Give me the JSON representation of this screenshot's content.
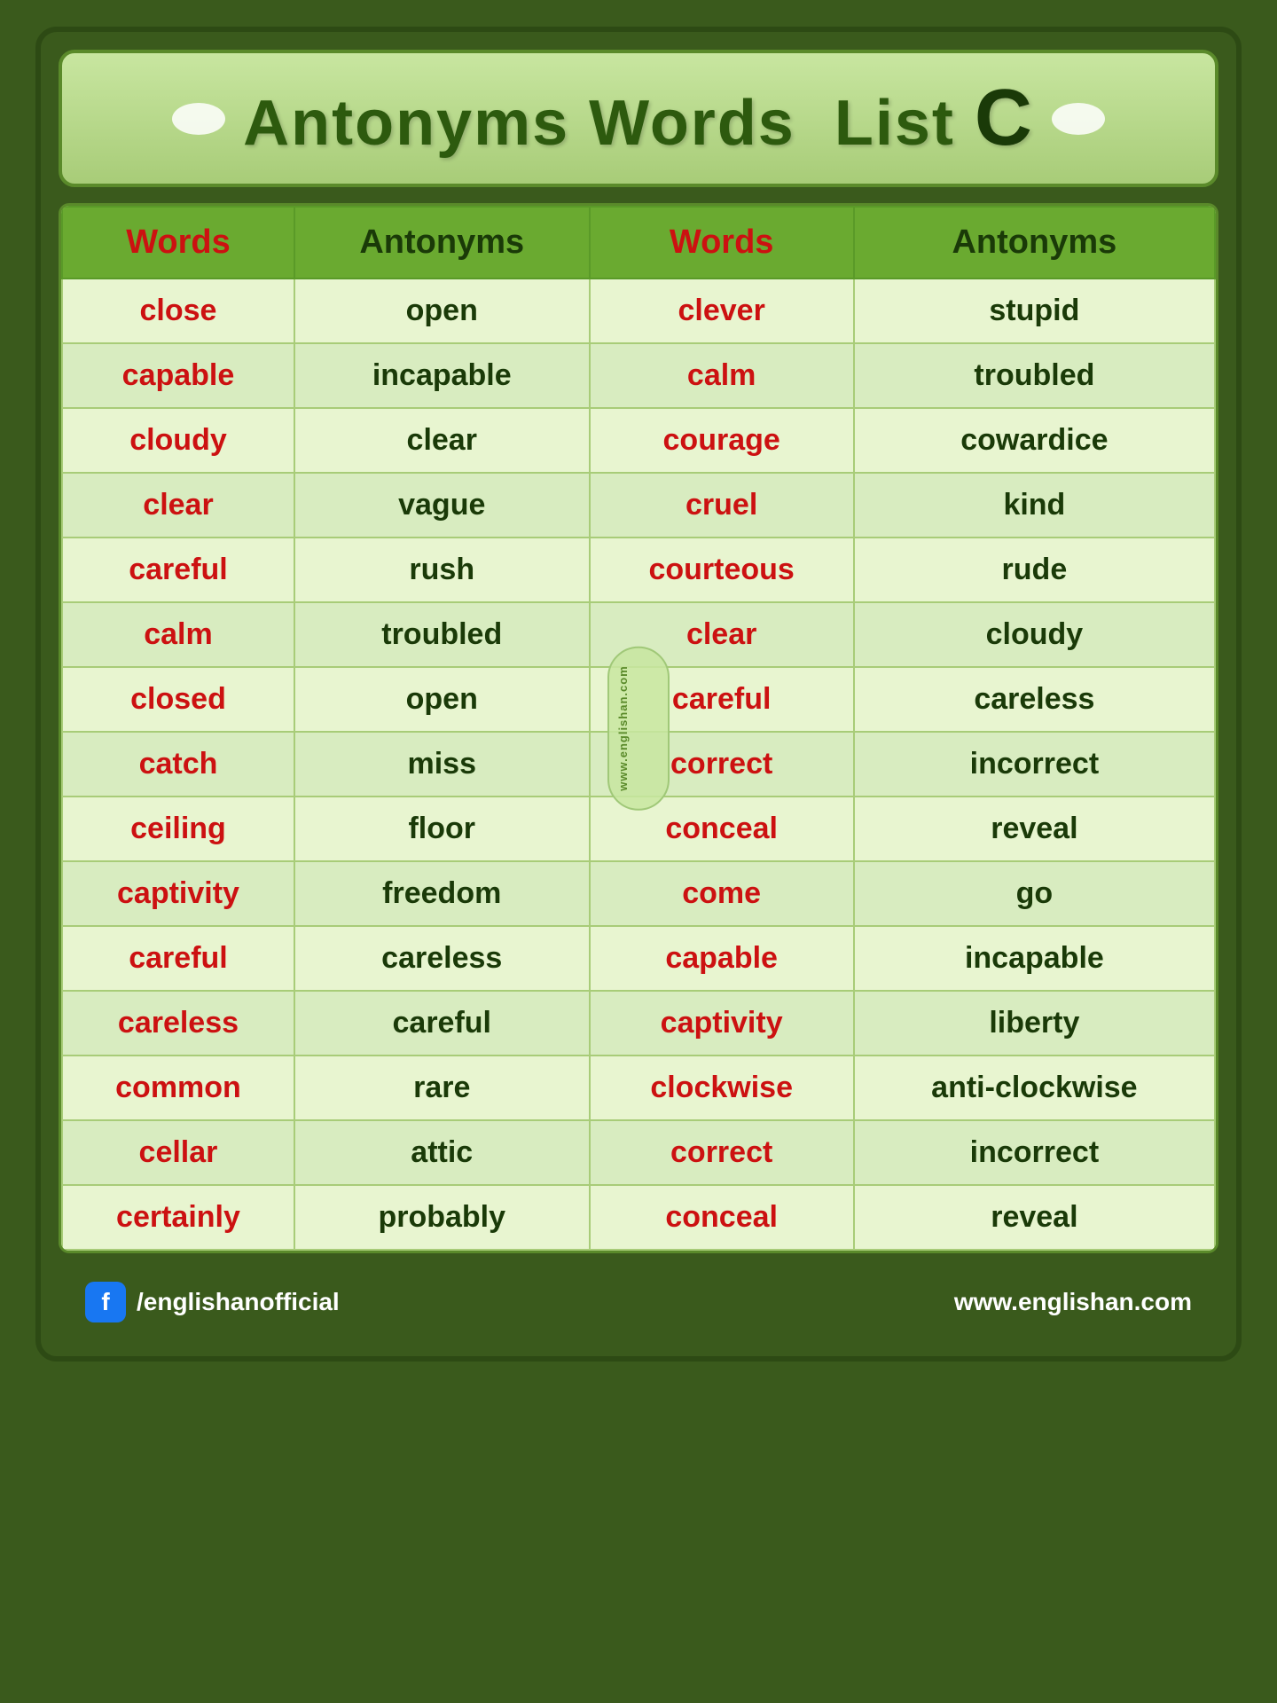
{
  "header": {
    "title": "Antonyms Words  List",
    "letter": "C",
    "oval_count": 2
  },
  "columns": {
    "col1_header": "Words",
    "col2_header": "Antonyms",
    "col3_header": "Words",
    "col4_header": "Antonyms"
  },
  "rows": [
    {
      "word1": "close",
      "ant1": "open",
      "word2": "clever",
      "ant2": "stupid"
    },
    {
      "word1": "capable",
      "ant1": "incapable",
      "word2": "calm",
      "ant2": "troubled"
    },
    {
      "word1": "cloudy",
      "ant1": "clear",
      "word2": "courage",
      "ant2": "cowardice"
    },
    {
      "word1": "clear",
      "ant1": "vague",
      "word2": "cruel",
      "ant2": "kind"
    },
    {
      "word1": "careful",
      "ant1": "rush",
      "word2": "courteous",
      "ant2": "rude"
    },
    {
      "word1": "calm",
      "ant1": "troubled",
      "word2": "clear",
      "ant2": "cloudy"
    },
    {
      "word1": "closed",
      "ant1": "open",
      "word2": "careful",
      "ant2": "careless"
    },
    {
      "word1": "catch",
      "ant1": "miss",
      "word2": "correct",
      "ant2": "incorrect"
    },
    {
      "word1": "ceiling",
      "ant1": "floor",
      "word2": "conceal",
      "ant2": "reveal"
    },
    {
      "word1": "captivity",
      "ant1": "freedom",
      "word2": "come",
      "ant2": "go"
    },
    {
      "word1": "careful",
      "ant1": "careless",
      "word2": "capable",
      "ant2": "incapable"
    },
    {
      "word1": "careless",
      "ant1": "careful",
      "word2": "captivity",
      "ant2": "liberty"
    },
    {
      "word1": "common",
      "ant1": "rare",
      "word2": "clockwise",
      "ant2": "anti-clockwise"
    },
    {
      "word1": "cellar",
      "ant1": "attic",
      "word2": "correct",
      "ant2": "incorrect"
    },
    {
      "word1": "certainly",
      "ant1": "probably",
      "word2": "conceal",
      "ant2": "reveal"
    }
  ],
  "watermark": "www.englishan.com",
  "footer": {
    "social": "/englishanofficial",
    "website": "www.englishan.com",
    "fb_label": "f"
  }
}
